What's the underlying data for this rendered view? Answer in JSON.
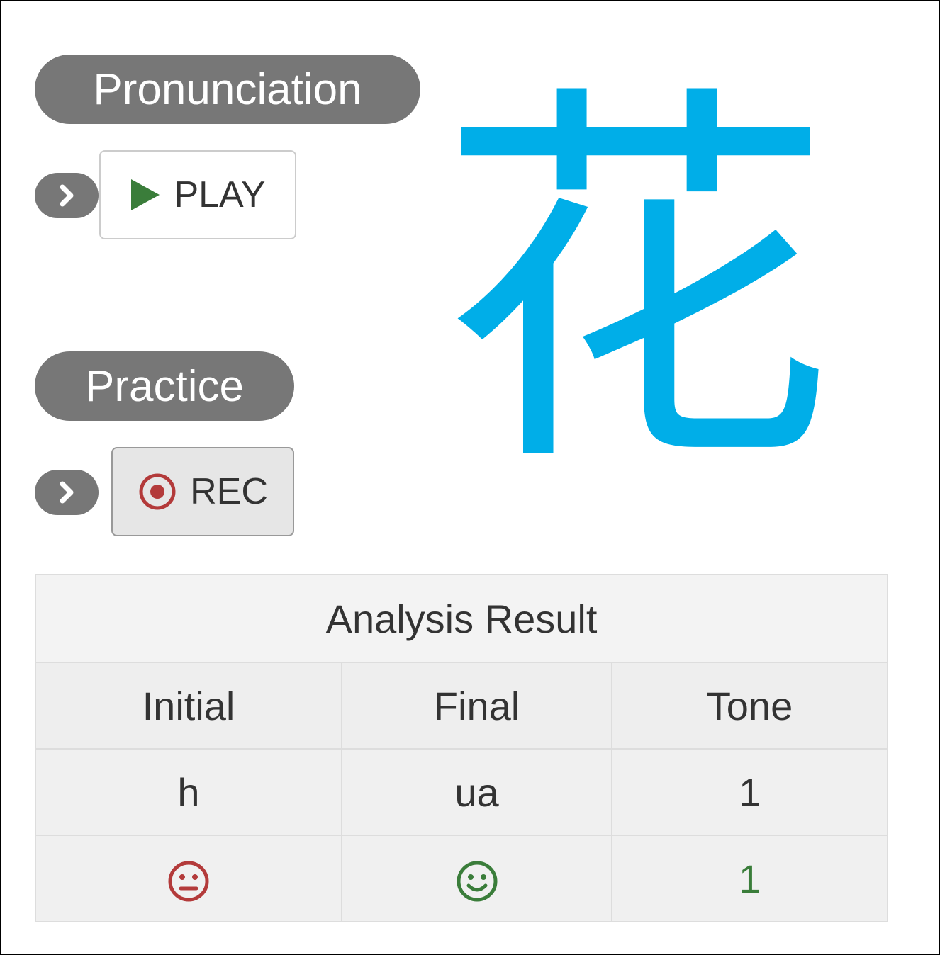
{
  "sections": {
    "pronunciation_label": "Pronunciation",
    "practice_label": "Practice"
  },
  "buttons": {
    "play_label": "PLAY",
    "rec_label": "REC"
  },
  "character": "花",
  "analysis": {
    "title": "Analysis Result",
    "columns": [
      "Initial",
      "Final",
      "Tone"
    ],
    "values": [
      "h",
      "ua",
      "1"
    ],
    "tone_score": "1",
    "feedback": {
      "initial": "neutral-face-icon",
      "final": "smiley-face-icon"
    }
  },
  "colors": {
    "pill_bg": "#777777",
    "character": "#00aee8",
    "play_icon": "#3a7d3a",
    "rec_icon": "#b33a3a",
    "feedback_bad": "#b33a3a",
    "feedback_good": "#3a7d3a"
  }
}
